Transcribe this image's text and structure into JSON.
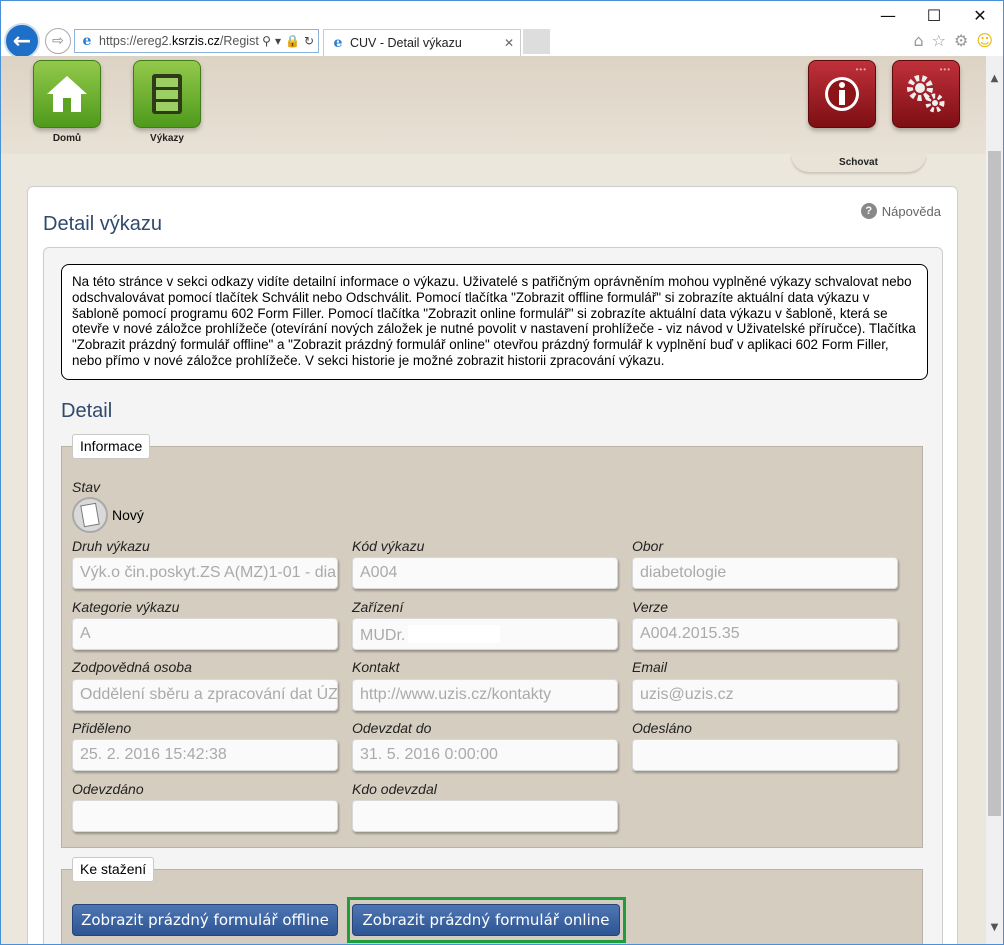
{
  "browser": {
    "url_host": "https://ereg2.",
    "url_domain": "ksrzis.cz",
    "url_path": "/Regist",
    "tab_title": "CUV - Detail výkazu"
  },
  "nav": {
    "home_label": "Domů",
    "reports_label": "Výkazy",
    "hide_label": "Schovat"
  },
  "page": {
    "help_label": "Nápověda",
    "title": "Detail výkazu",
    "info_text": "Na této stránce v sekci odkazy vidíte detailní informace o výkazu. Uživatelé s patřičným oprávněním mohou vyplněné výkazy schvalovat nebo odschvalovávat pomocí tlačítek Schválit nebo Odschválit. Pomocí tlačítka \"Zobrazit offline formulář\" si zobrazíte aktuální data výkazu v šabloně pomocí programu 602 Form Filler. Pomocí tlačítka \"Zobrazit online formulář\" si zobrazíte aktuální data výkazu v šabloně, která se otevře v nové záložce prohlížeče (otevírání nových záložek je nutné povolit v nastavení prohlížeče - viz návod v Uživatelské příručce). Tlačítka \"Zobrazit prázdný formulář offline\" a \"Zobrazit prázdný formulář online\" otevřou prázdný formulář k vyplnění buď v aplikaci 602 Form Filler, nebo přímo v nové záložce prohlížeče. V sekci historie je možné zobrazit historii zpracování výkazu.",
    "section_title": "Detail"
  },
  "info": {
    "legend": "Informace",
    "stav_label": "Stav",
    "stav_value": "Nový",
    "fields": {
      "druh_label": "Druh výkazu",
      "druh_value": "Výk.o čin.poskyt.ZS A(MZ)1-01 - dia",
      "kod_label": "Kód výkazu",
      "kod_value": "A004",
      "obor_label": "Obor",
      "obor_value": "diabetologie",
      "kategorie_label": "Kategorie výkazu",
      "kategorie_value": "A",
      "zarizeni_label": "Zařízení",
      "zarizeni_value": "MUDr.",
      "verze_label": "Verze",
      "verze_value": "A004.2015.35",
      "osoba_label": "Zodpovědná osoba",
      "osoba_value": "Oddělení sběru a zpracování dat ÚZ",
      "kontakt_label": "Kontakt",
      "kontakt_value": "http://www.uzis.cz/kontakty",
      "email_label": "Email",
      "email_value": "uzis@uzis.cz",
      "prideleno_label": "Přiděleno",
      "prideleno_value": "25. 2. 2016 15:42:38",
      "odevzdat_label": "Odevzdat do",
      "odevzdat_value": "31. 5. 2016 0:00:00",
      "odeslano_label": "Odesláno",
      "odeslano_value": "",
      "odevzdano_label": "Odevzdáno",
      "odevzdano_value": "",
      "kdo_label": "Kdo odevzdal",
      "kdo_value": ""
    }
  },
  "downloads": {
    "legend": "Ke stažení",
    "offline_button": "Zobrazit prázdný formulář offline",
    "online_button": "Zobrazit prázdný formulář online"
  }
}
